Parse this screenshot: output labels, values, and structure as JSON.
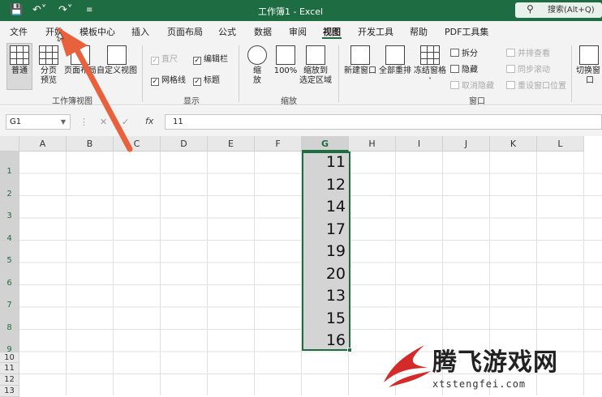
{
  "window": {
    "title": "工作簿1 - Excel",
    "search_placeholder": "搜索(Alt+Q)"
  },
  "quick_access": {
    "save_icon": "save-icon",
    "undo_icon": "undo-icon",
    "redo_icon": "redo-icon"
  },
  "tabs": [
    "文件",
    "开始",
    "模板中心",
    "插入",
    "页面布局",
    "公式",
    "数据",
    "审阅",
    "视图",
    "开发工具",
    "帮助",
    "PDF工具集"
  ],
  "active_tab": "视图",
  "ribbon": {
    "workbook_views": {
      "label": "工作簿视图",
      "normal": "普通",
      "page_break_1": "分页",
      "page_break_2": "预览",
      "page_layout": "页面布局",
      "custom": "自定义视图"
    },
    "show": {
      "label": "显示",
      "ruler": "直尺",
      "formula_bar": "编辑栏",
      "gridlines": "网格线",
      "headings": "标题"
    },
    "zoom": {
      "label": "缩放",
      "zoom_1": "缩",
      "zoom_2": "放",
      "hundred": "100%",
      "to_sel_1": "缩放到",
      "to_sel_2": "选定区域"
    },
    "window": {
      "label": "窗口",
      "new_window": "新建窗口",
      "arrange_all": "全部重排",
      "freeze": "冻结窗格",
      "split": "拆分",
      "hide": "隐藏",
      "unhide": "取消隐藏",
      "side_by_side": "并排查看",
      "sync_scroll": "同步滚动",
      "reset_position": "重设窗口位置",
      "switch_1": "切换窗",
      "switch_2": "口"
    }
  },
  "formula_bar": {
    "name_box": "G1",
    "fx": "fx",
    "value": "11"
  },
  "columns": [
    "A",
    "B",
    "C",
    "D",
    "E",
    "F",
    "G",
    "H",
    "I",
    "J",
    "K",
    "L"
  ],
  "selected_column": "G",
  "rows": [
    "1",
    "2",
    "3",
    "4",
    "5",
    "6",
    "7",
    "8",
    "9",
    "10",
    "11",
    "12",
    "13"
  ],
  "column_g_values": [
    "11",
    "12",
    "14",
    "17",
    "19",
    "20",
    "13",
    "15",
    "16"
  ],
  "watermark": {
    "name": "腾飞游戏网",
    "url": "xtstengfei.com"
  }
}
